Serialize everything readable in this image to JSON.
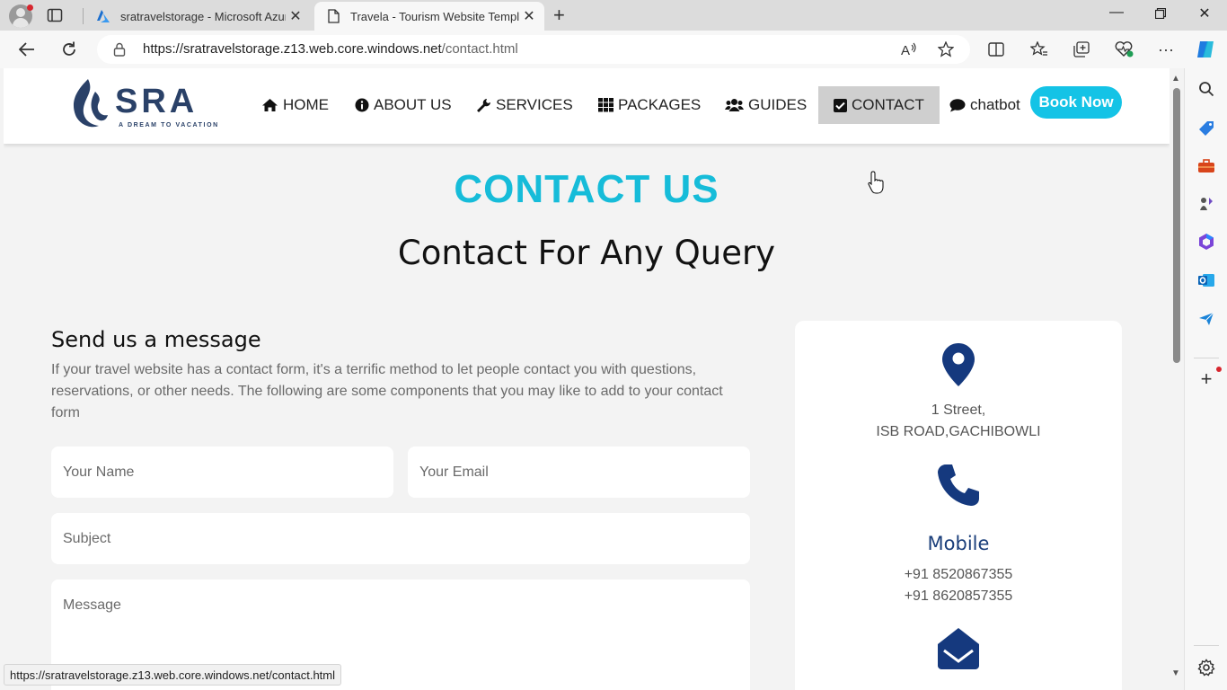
{
  "browser": {
    "tabs": [
      {
        "label": "sratravelstorage - Microsoft Azur",
        "icon": "azure-icon"
      },
      {
        "label": "Travela - Tourism Website Templa",
        "icon": "page-icon"
      }
    ],
    "url_host": "https://sratravelstorage.z13.web.core.windows.net",
    "url_path": "/contact.html",
    "status_url": "https://sratravelstorage.z13.web.core.windows.net/contact.html"
  },
  "site": {
    "logo_text": "SRA",
    "logo_tagline": "A DREAM TO VACATION",
    "menu": [
      {
        "label": "HOME",
        "icon": "home-icon"
      },
      {
        "label": "ABOUT US",
        "icon": "info-icon"
      },
      {
        "label": "SERVICES",
        "icon": "wrench-icon"
      },
      {
        "label": "PACKAGES",
        "icon": "grid-icon"
      },
      {
        "label": "GUIDES",
        "icon": "users-icon"
      },
      {
        "label": "CONTACT",
        "icon": "check-square-icon",
        "active": true
      },
      {
        "label": "chatbot",
        "icon": "comment-icon"
      }
    ],
    "book_now": "Book Now",
    "accent_color": "#16bcd9"
  },
  "contact": {
    "title": "CONTACT US",
    "subtitle": "Contact For Any Query",
    "form_heading": "Send us a message",
    "form_intro": "If your travel website has a contact form, it's a terrific method to let people contact you with questions, reservations, or other needs. The following are some components that you may like to add to your contact form",
    "placeholders": {
      "name": "Your Name",
      "email": "Your Email",
      "subject": "Subject",
      "message": "Message"
    }
  },
  "info": {
    "address_line1": "1 Street,",
    "address_line2": "ISB ROAD,GACHIBOWLI",
    "mobile_heading": "Mobile",
    "phone1": "+91 8520867355",
    "phone2": "+91 8620857355"
  }
}
